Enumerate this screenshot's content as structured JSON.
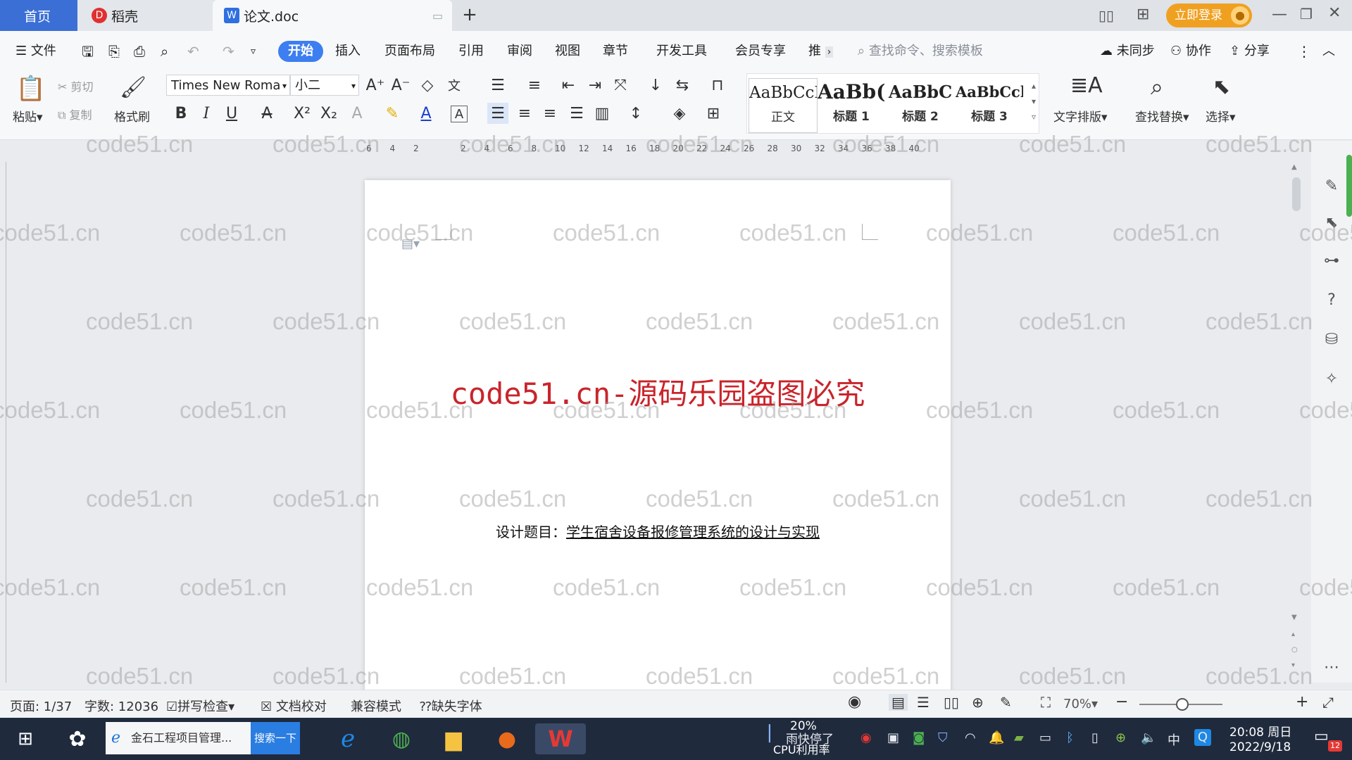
{
  "tabs": {
    "home": "首页",
    "daoke": "稻壳",
    "doc": "论文.doc",
    "login_button": "立即登录"
  },
  "menu": {
    "file": "文件",
    "items": [
      "开始",
      "插入",
      "页面布局",
      "引用",
      "审阅",
      "视图",
      "章节",
      "开发工具",
      "会员专享",
      "推"
    ],
    "search_placeholder": "查找命令、搜索模板",
    "sync": "未同步",
    "collab": "协作",
    "share": "分享"
  },
  "ribbon": {
    "paste": "粘贴",
    "cut": "剪切",
    "copy": "复制",
    "format_painter": "格式刷",
    "font_name": "Times New Roma",
    "font_size": "小二",
    "styles": [
      {
        "sample": "AaBbCcI",
        "label": "正文"
      },
      {
        "sample": "AaBb(",
        "label": "标题 1"
      },
      {
        "sample": "AaBbC",
        "label": "标题 2"
      },
      {
        "sample": "AaBbCcl",
        "label": "标题 3"
      }
    ],
    "text_layout": "文字排版",
    "find_replace": "查找替换",
    "select": "选择"
  },
  "ruler": {
    "marks": [
      "6",
      "4",
      "2",
      "",
      "2",
      "4",
      "6",
      "8",
      "10",
      "12",
      "14",
      "16",
      "18",
      "20",
      "22",
      "24",
      "26",
      "28",
      "30",
      "32",
      "34",
      "36",
      "38",
      "40"
    ]
  },
  "document": {
    "watermark_title": "code51.cn-源码乐园盗图必究",
    "design_label": "设计题目：",
    "design_title": "学生宿舍设备报修管理系统的设计与实现",
    "watermark": "code51.cn"
  },
  "statusbar": {
    "page": "页面: 1/37",
    "words": "字数: 12036",
    "spell": "拼写检查",
    "proof": "文档校对",
    "compat": "兼容模式",
    "missing_font": "缺失字体",
    "zoom": "70%",
    "zoom_fraction": 0.7
  },
  "taskbar": {
    "ie_task": "金石工程项目管理...",
    "search_button": "搜索一下",
    "cpu_percent": "20%",
    "cpu_label": "CPU利用率",
    "notice": "雨快停了",
    "ime": "中",
    "time": "20:08 周日",
    "date": "2022/9/18",
    "badge": "12"
  },
  "colors": {
    "accent": "#3d7ef0",
    "home_tab": "#3b6fd6",
    "login": "#f0a020",
    "watermark_red": "#c9242b",
    "taskbar": "#1f2a3d"
  }
}
